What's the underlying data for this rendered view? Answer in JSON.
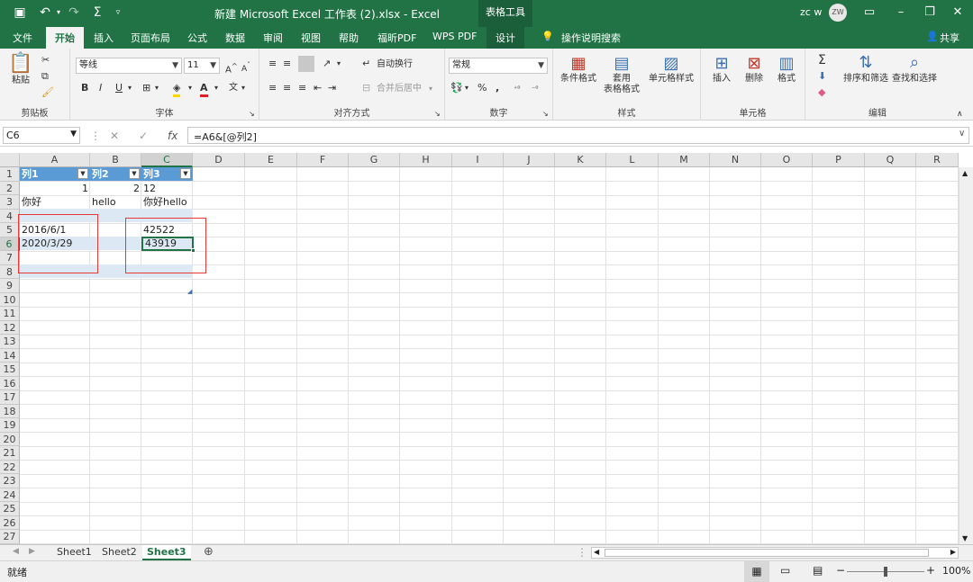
{
  "title": "新建 Microsoft Excel 工作表 (2).xlsx  -  Excel",
  "context_tool": "表格工具",
  "user": {
    "name": "zc w",
    "initials": "ZW"
  },
  "tabs": [
    "文件",
    "开始",
    "插入",
    "页面布局",
    "公式",
    "数据",
    "审阅",
    "视图",
    "帮助",
    "福昕PDF",
    "WPS PDF",
    "设计"
  ],
  "tell_me": "操作说明搜索",
  "share": "共享",
  "ribbon": {
    "clipboard": {
      "paste": "粘贴",
      "label": "剪贴板"
    },
    "font": {
      "name": "等线",
      "size": "11",
      "bold": "B",
      "italic": "I",
      "underline": "U",
      "label": "字体"
    },
    "alignment": {
      "wrap": "自动换行",
      "merge": "合并后居中",
      "label": "对齐方式"
    },
    "number": {
      "format": "常规",
      "percent": "%",
      "comma": ",",
      "label": "数字"
    },
    "styles": {
      "conditional": "条件格式",
      "table_line1": "套用",
      "table_line2": "表格格式",
      "cell_styles": "单元格样式",
      "label": "样式"
    },
    "cells": {
      "insert": "插入",
      "delete": "删除",
      "format": "格式",
      "label": "单元格"
    },
    "editing": {
      "sort": "排序和筛选",
      "find": "查找和选择",
      "label": "编辑"
    }
  },
  "formula_bar": {
    "name_box": "C6",
    "formula": "=A6&[@列2]",
    "fx": "fx"
  },
  "columns": [
    "A",
    "B",
    "C",
    "D",
    "E",
    "F",
    "G",
    "H",
    "I",
    "J",
    "K",
    "L",
    "M",
    "N",
    "O",
    "P",
    "Q",
    "R"
  ],
  "rows": [
    "1",
    "2",
    "3",
    "4",
    "5",
    "6",
    "7",
    "8",
    "9",
    "10",
    "11",
    "12",
    "13",
    "14",
    "15",
    "16",
    "17",
    "18",
    "19",
    "20",
    "21",
    "22",
    "23",
    "24",
    "25",
    "26",
    "27"
  ],
  "table": {
    "headers": [
      "列1",
      "列2",
      "列3"
    ],
    "r2": {
      "a": "1",
      "b": "2",
      "c": "12"
    },
    "r3": {
      "a": "你好",
      "b": "hello",
      "c": "你好hello"
    },
    "r5": {
      "a": "2016/6/1",
      "c": "42522"
    },
    "r6": {
      "a": "2020/3/29",
      "c": "43919"
    }
  },
  "sheets": [
    "Sheet1",
    "Sheet2",
    "Sheet3"
  ],
  "active_sheet": "Sheet3",
  "status": {
    "ready": "就绪",
    "zoom": "100%"
  },
  "colors": {
    "accent": "#217346",
    "table_header": "#5b9bd5",
    "table_band": "#dde8f5",
    "highlight_box": "#e53935"
  }
}
